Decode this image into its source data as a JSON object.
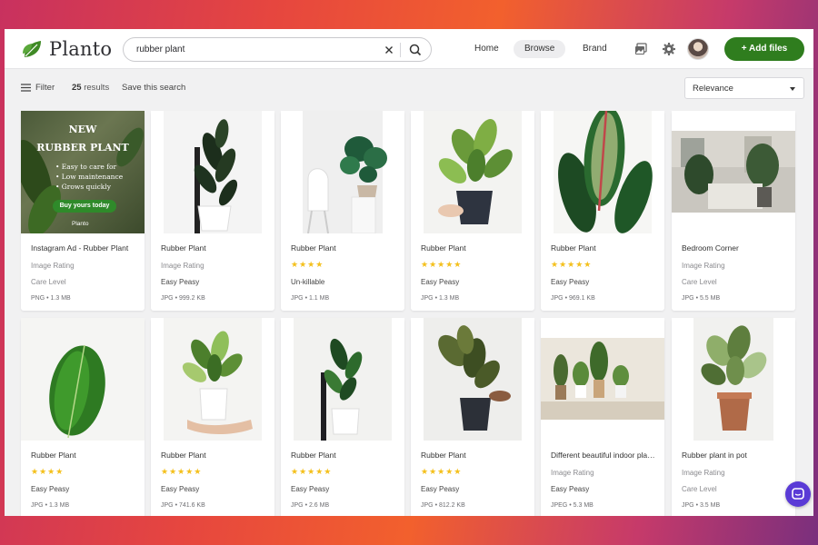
{
  "header": {
    "logo_text": "Planto",
    "search_value": "rubber plant",
    "nav": [
      "Home",
      "Browse",
      "Brand"
    ],
    "active_nav": "Browse",
    "add_files_label": "+ Add files"
  },
  "toolbar": {
    "filter_label": "Filter",
    "results_count": "25",
    "results_label": "results",
    "save_search_label": "Save this search",
    "sort_value": "Relevance"
  },
  "ad": {
    "headline_1": "NEW",
    "headline_2": "RUBBER PLANT",
    "bullets": [
      "• Easy to care for",
      "• Low maintenance",
      "• Grows quickly"
    ],
    "cta": "Buy yours today",
    "brand": "Planto"
  },
  "cards": [
    {
      "title": "Instagram Ad - Rubber Plant",
      "line2": "Image Rating",
      "line3": "Care Level",
      "type": "PNG",
      "size": "1.3 MB",
      "rating": 0,
      "stars": ""
    },
    {
      "title": "Rubber Plant",
      "line2": "Image Rating",
      "line3": "Easy Peasy",
      "type": "JPG",
      "size": "999.2 KB",
      "rating": 0,
      "stars": ""
    },
    {
      "title": "Rubber Plant",
      "line2": "",
      "line3": "Un-killable",
      "type": "JPG",
      "size": "1.1 MB",
      "rating": 4,
      "stars": "★★★★"
    },
    {
      "title": "Rubber Plant",
      "line2": "",
      "line3": "Easy Peasy",
      "type": "JPG",
      "size": "1.3 MB",
      "rating": 5,
      "stars": "★★★★★"
    },
    {
      "title": "Rubber Plant",
      "line2": "",
      "line3": "Easy Peasy",
      "type": "JPG",
      "size": "969.1 KB",
      "rating": 5,
      "stars": "★★★★★"
    },
    {
      "title": "Bedroom Corner",
      "line2": "Image Rating",
      "line3": "Care Level",
      "type": "JPG",
      "size": "5.5 MB",
      "rating": 0,
      "stars": ""
    },
    {
      "title": "Rubber Plant",
      "line2": "",
      "line3": "Easy Peasy",
      "type": "JPG",
      "size": "1.3 MB",
      "rating": 4,
      "stars": "★★★★"
    },
    {
      "title": "Rubber Plant",
      "line2": "",
      "line3": "Easy Peasy",
      "type": "JPG",
      "size": "741.6 KB",
      "rating": 5,
      "stars": "★★★★★"
    },
    {
      "title": "Rubber Plant",
      "line2": "",
      "line3": "Easy Peasy",
      "type": "JPG",
      "size": "2.6 MB",
      "rating": 5,
      "stars": "★★★★★"
    },
    {
      "title": "Rubber Plant",
      "line2": "",
      "line3": "Easy Peasy",
      "type": "JPG",
      "size": "812.2 KB",
      "rating": 5,
      "stars": "★★★★★"
    },
    {
      "title": "Different beautiful indoor plants",
      "line2": "Image Rating",
      "line3": "Easy Peasy",
      "type": "JPEG",
      "size": "5.3 MB",
      "rating": 0,
      "stars": ""
    },
    {
      "title": "Rubber plant in pot",
      "line2": "Image Rating",
      "line3": "Care Level",
      "type": "JPG",
      "size": "3.5 MB",
      "rating": 0,
      "stars": ""
    }
  ],
  "colors": {
    "accent_green": "#2f7d1e",
    "star": "#f4c01c",
    "chat": "#5a3bd6"
  },
  "icons": {
    "clear": "close-icon",
    "search": "search-icon",
    "gallery": "image-gallery-icon",
    "settings": "gear-icon",
    "filter": "filter-icon",
    "chat": "chat-icon"
  }
}
